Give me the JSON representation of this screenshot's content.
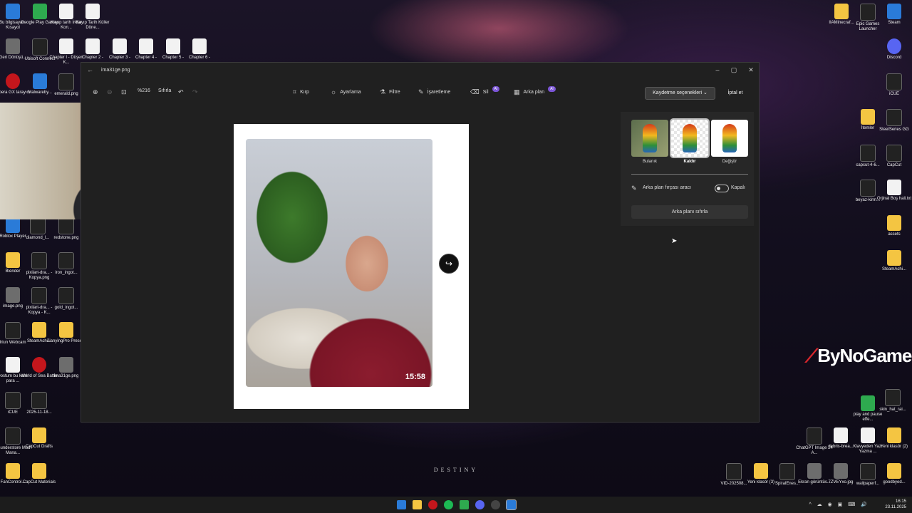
{
  "desktop": {
    "icons_left": [
      {
        "label": "Bu bilgisayar - Kısayol",
        "kind": "blue"
      },
      {
        "label": "Google Play Games",
        "kind": "green"
      },
      {
        "label": "Kayıp tarih İrklar Kon...",
        "kind": "doc"
      },
      {
        "label": "Kayıp Tarih Küller Döne...",
        "kind": "doc"
      },
      {
        "label": "Geri Dönüşü...",
        "kind": "gray"
      },
      {
        "label": "Ubisoft Connect",
        "kind": "dark"
      },
      {
        "label": "Chapter I - Düşen K...",
        "kind": "doc"
      },
      {
        "label": "Chapter 2 -",
        "kind": "doc"
      },
      {
        "label": "Chapter 3 -",
        "kind": "doc"
      },
      {
        "label": "Chapter 4 -",
        "kind": "doc"
      },
      {
        "label": "Chapter 5 -",
        "kind": "doc"
      },
      {
        "label": "Chapter 6 -",
        "kind": "doc"
      },
      {
        "label": "Opera GX tarayıcı",
        "kind": "red"
      },
      {
        "label": "Malwareby...",
        "kind": "blue"
      },
      {
        "label": "emerald.png",
        "kind": "dark"
      },
      {
        "label": "Roblox Player",
        "kind": "blue"
      },
      {
        "label": "diamond_l...",
        "kind": "dark"
      },
      {
        "label": "redstone.png",
        "kind": "dark"
      },
      {
        "label": "Blender",
        "kind": "folder"
      },
      {
        "label": "pixilart-dra... - Kopya.png",
        "kind": "dark"
      },
      {
        "label": "iron_ingot...",
        "kind": "dark"
      },
      {
        "label": "image.png",
        "kind": "gray"
      },
      {
        "label": "pixilart-dra... - Kopya - K...",
        "kind": "dark"
      },
      {
        "label": "gold_ingot...",
        "kind": "dark"
      },
      {
        "label": "Iriun Webcam",
        "kind": "dark"
      },
      {
        "label": "SteamAchi...",
        "kind": "folder"
      },
      {
        "label": "JianyingPro Presets",
        "kind": "folder"
      },
      {
        "label": "Dostum bu kanlı para ...",
        "kind": "doc"
      },
      {
        "label": "World of Sea Battle",
        "kind": "red"
      },
      {
        "label": "ima31ge.png",
        "kind": "gray"
      },
      {
        "label": "iCUE",
        "kind": "dark"
      },
      {
        "label": "2025-11-18...",
        "kind": "dark"
      },
      {
        "label": "Thunderstore Mod Mana...",
        "kind": "dark"
      },
      {
        "label": "CapCut Drafts",
        "kind": "folder"
      },
      {
        "label": "FanControl...",
        "kind": "folder"
      },
      {
        "label": "CapCut Materials",
        "kind": "folder"
      }
    ],
    "icons_right": [
      {
        "label": "IIAMinecraf...",
        "kind": "folder"
      },
      {
        "label": "Epic Games Launcher",
        "kind": "dark"
      },
      {
        "label": "Steam",
        "kind": "blue"
      },
      {
        "label": "Discord",
        "kind": "purple"
      },
      {
        "label": "iCUE",
        "kind": "dark"
      },
      {
        "label": "İtemler",
        "kind": "folder"
      },
      {
        "label": "SteelSeries GG",
        "kind": "dark"
      },
      {
        "label": "capcut-4-6...",
        "kind": "dark"
      },
      {
        "label": "CapCut",
        "kind": "dark"
      },
      {
        "label": "beyaz-kirm...",
        "kind": "dark"
      },
      {
        "label": "Orjinal Boş hali.txt",
        "kind": "doc"
      },
      {
        "label": "assets",
        "kind": "folder"
      },
      {
        "label": "SteamAchi...",
        "kind": "folder"
      },
      {
        "label": "play and pause effe...",
        "kind": "green"
      },
      {
        "label": "skin_hat_rai...",
        "kind": "dark"
      },
      {
        "label": "ChatGPT Image 24 A...",
        "kind": "dark"
      },
      {
        "label": "debris-brea...",
        "kind": "doc"
      },
      {
        "label": "Klavyeden Yazı Yazma ...",
        "kind": "doc"
      },
      {
        "label": "Yeni klasör (2)",
        "kind": "folder"
      },
      {
        "label": "VID-202508...",
        "kind": "dark"
      },
      {
        "label": "Yeni klasör (3)",
        "kind": "folder"
      },
      {
        "label": "SpiralEnes...",
        "kind": "dark"
      },
      {
        "label": "Ekran görüntüs...",
        "kind": "gray"
      },
      {
        "label": "7ZVEYxo.jpg",
        "kind": "gray"
      },
      {
        "label": "wallpaperf...",
        "kind": "dark"
      },
      {
        "label": "goodbyed...",
        "kind": "folder"
      }
    ],
    "brand": "ByNoGame",
    "wallpaper_text": "DESTINY"
  },
  "photos_window": {
    "file_name": "ima31ge.png",
    "window_controls": {
      "minimize": "–",
      "maximize": "▢",
      "close": "✕"
    },
    "toolbar": {
      "zoom": "%216",
      "reset": "Sıfırla",
      "crop": "Kırp",
      "adjust": "Ayarlama",
      "filter": "Filtre",
      "markup": "İşaretleme",
      "erase": "Sil",
      "background": "Arka plan",
      "ai_badge": "AI"
    },
    "save_options": "Kaydetme seçenekleri",
    "cancel": "İptal et",
    "photo_timestamp": "15:58",
    "background_panel": {
      "options": [
        {
          "label": "Bulanık",
          "active": false
        },
        {
          "label": "Kaldır",
          "active": true
        },
        {
          "label": "Değiştir",
          "active": false
        }
      ],
      "brush_tool": "Arka plan fırçası aracı",
      "brush_state": "Kapalı",
      "reset_background": "Arka planı sıfırla"
    }
  },
  "taskbar": {
    "time": "16:15",
    "date": "23.11.2025",
    "tray": "^ ☁ ◉ ▣ ⌨ 🔊"
  },
  "colors": {
    "accent_ai": "#7b55d6",
    "window_bg": "#202020",
    "panel_bg": "#272727",
    "brand_red": "#d7262c"
  }
}
